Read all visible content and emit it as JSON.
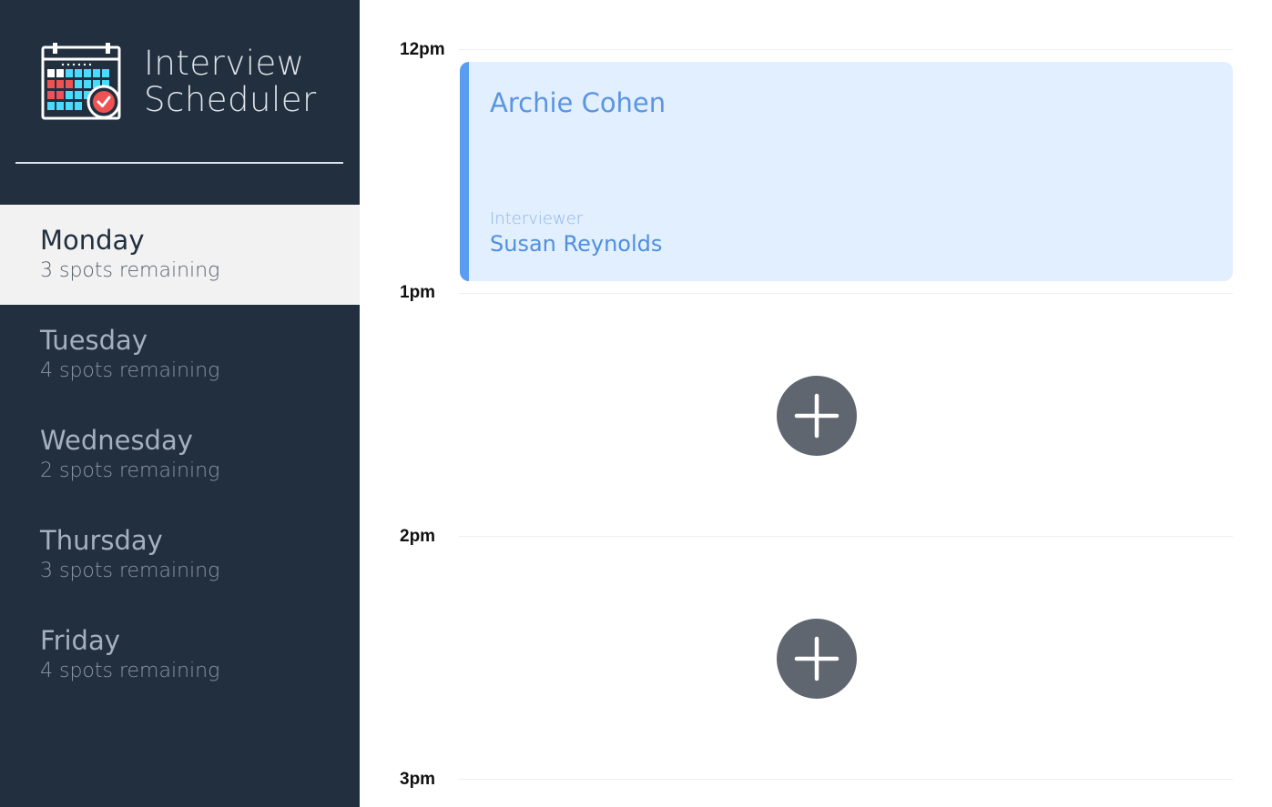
{
  "sidebar": {
    "brand_line1": "Interview",
    "brand_line2": "Scheduler",
    "logo_icon": "calendar-check-icon",
    "days": [
      {
        "name": "Monday",
        "spots": "3 spots remaining",
        "selected": true
      },
      {
        "name": "Tuesday",
        "spots": "4 spots remaining",
        "selected": false
      },
      {
        "name": "Wednesday",
        "spots": "2 spots remaining",
        "selected": false
      },
      {
        "name": "Thursday",
        "spots": "3 spots remaining",
        "selected": false
      },
      {
        "name": "Friday",
        "spots": "4 spots remaining",
        "selected": false
      }
    ]
  },
  "schedule": {
    "hours": [
      "12pm",
      "1pm",
      "2pm",
      "3pm"
    ],
    "appointment": {
      "student": "Archie Cohen",
      "interviewer_label": "Interviewer",
      "interviewer_name": "Susan Reynolds"
    },
    "add_icon": "plus-icon"
  },
  "colors": {
    "sidebar_bg": "#222f3e",
    "appointment_bg": "#e2efff",
    "appointment_accent": "#5a9cf2",
    "add_button": "#5f6670"
  }
}
